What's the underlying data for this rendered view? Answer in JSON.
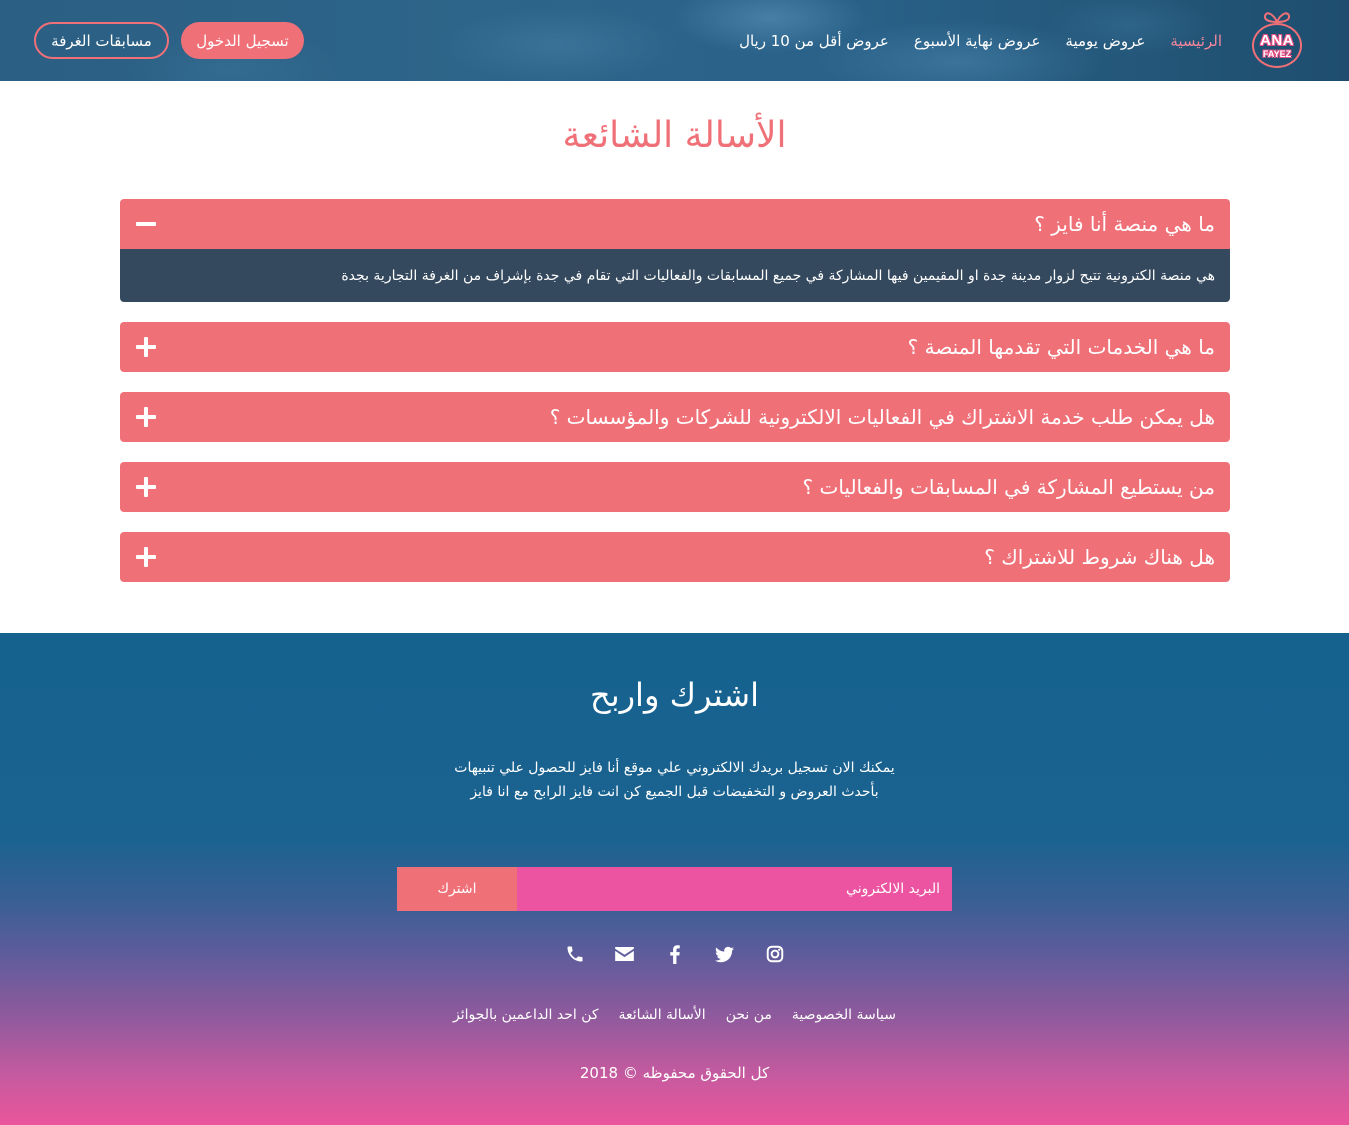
{
  "theme": {
    "accent": "#f07078",
    "nav_active": "#f4879c",
    "answer_bg": "#34495e",
    "input_bg": "#ec54a1",
    "footer_top": "#15628f",
    "footer_bottom": "#ea559c"
  },
  "header": {
    "logo": {
      "line1": "ANA",
      "line2": "FAYEZ",
      "icon": "gift-bow-icon"
    },
    "nav": [
      {
        "label": "الرئيسية",
        "active": true
      },
      {
        "label": "عروض يومية",
        "active": false
      },
      {
        "label": "عروض نهاية الأسبوع",
        "active": false
      },
      {
        "label": "عروض أقل من 10 ريال",
        "active": false
      }
    ],
    "login_label": "تسجيل الدخول",
    "contests_label": "مسابقات الغرفة"
  },
  "faq": {
    "title": "الأسالة الشائعة",
    "items": [
      {
        "question": "ما هي منصة أنا فايز ؟",
        "expanded": true,
        "toggle_icon": "minus-icon",
        "answer": "هي منصة الكترونية تتيح لزوار مدينة جدة او المقيمين فيها المشاركة في جميع المسابقات والفعاليات التي تقام في جدة بإشراف من الغرفة التجارية بجدة"
      },
      {
        "question": "ما هي الخدمات التي تقدمها المنصة ؟",
        "expanded": false,
        "toggle_icon": "plus-icon"
      },
      {
        "question": "هل يمكن طلب خدمة الاشتراك في الفعاليات الالكترونية للشركات والمؤسسات ؟",
        "expanded": false,
        "toggle_icon": "plus-icon"
      },
      {
        "question": "من يستطيع المشاركة في المسابقات والفعاليات ؟",
        "expanded": false,
        "toggle_icon": "plus-icon"
      },
      {
        "question": "هل هناك شروط للاشتراك ؟",
        "expanded": false,
        "toggle_icon": "plus-icon"
      }
    ]
  },
  "footer": {
    "title": "اشترك واربح",
    "description": "يمكنك الان تسجيل بريدك الالكتروني علي موقع أنا فايز للحصول علي تنبيهات بأحدث العروض و التخفيضات قبل الجميع كن انت فايز الرابح مع انا فايز",
    "subscribe": {
      "placeholder": "البريد الالكتروني",
      "button_label": "اشترك"
    },
    "social": [
      {
        "icon": "instagram-icon"
      },
      {
        "icon": "twitter-icon"
      },
      {
        "icon": "facebook-icon"
      },
      {
        "icon": "envelope-icon"
      },
      {
        "icon": "phone-icon"
      }
    ],
    "links": [
      {
        "label": "سياسة الخصوصية"
      },
      {
        "label": "من نحن"
      },
      {
        "label": "الأسالة الشائعة"
      },
      {
        "label": "كن احد الداعمين بالجوائز"
      }
    ],
    "copyright": "كل الحقوق محفوظه © 2018"
  }
}
